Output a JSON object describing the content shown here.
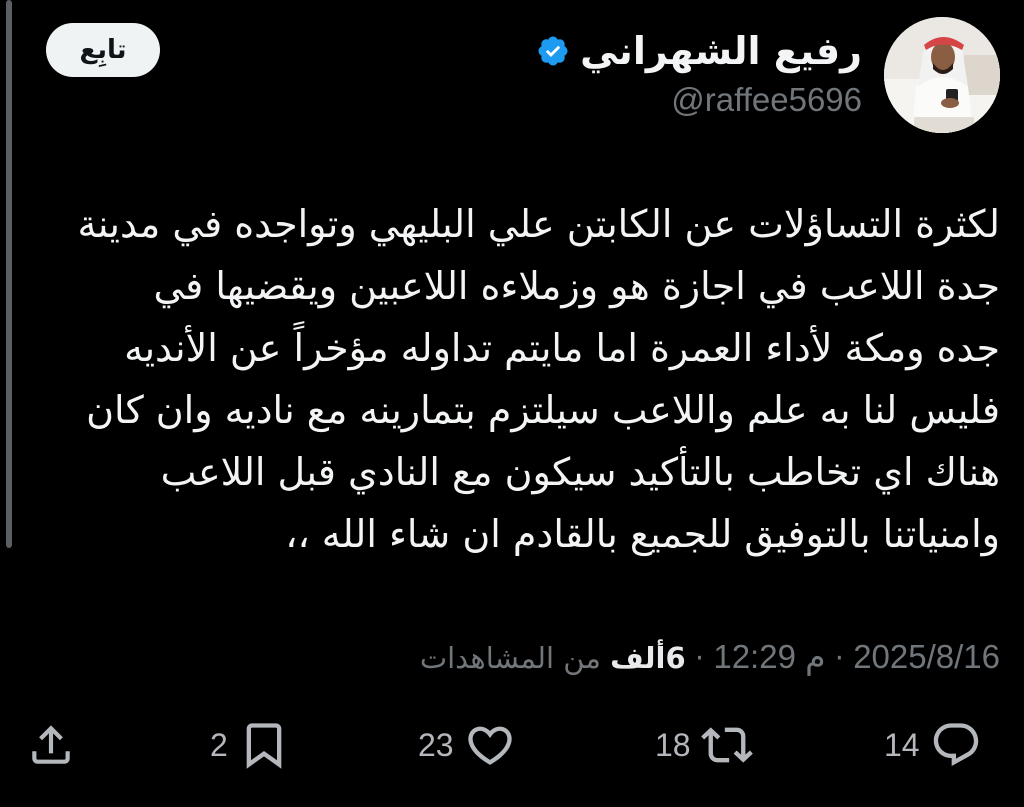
{
  "author": {
    "display_name": "رفيع الشهراني",
    "handle": "@raffee5696",
    "verified_icon": "verified-badge-icon",
    "verified_color": "#1d9bf0"
  },
  "follow_button": {
    "label": "تابِع"
  },
  "tweet": {
    "text": "لكثرة التساؤلات عن الكابتن علي البليهي وتواجده في مدينة\nجدة  اللاعب في اجازة هو وزملاءه اللاعبين ويقضيها في\nجده ومكة لأداء العمرة اما مايتم تداوله مؤخراً عن الأنديه\nفليس لنا به علم واللاعب سيلتزم بتمارينه مع ناديه وان كان\nهناك اي تخاطب بالتأكيد سيكون مع النادي قبل اللاعب\nوامنياتنا بالتوفيق للجميع بالقادم  ان شاء الله ،،"
  },
  "meta": {
    "date": "2025/8/16",
    "separator": "·",
    "time": "12:29 م",
    "views_count": "6ألف",
    "views_label": "من المشاهدات"
  },
  "actions": {
    "replies": {
      "count": "14",
      "icon": "reply-icon"
    },
    "reposts": {
      "count": "18",
      "icon": "repost-icon"
    },
    "likes": {
      "count": "23",
      "icon": "like-icon"
    },
    "bookmarks": {
      "count": "2",
      "icon": "bookmark-icon"
    },
    "share": {
      "icon": "share-icon"
    }
  },
  "colors": {
    "background": "#000000",
    "text": "#e7e9ea",
    "secondary": "#71767b",
    "button_bg": "#eff3f4"
  }
}
